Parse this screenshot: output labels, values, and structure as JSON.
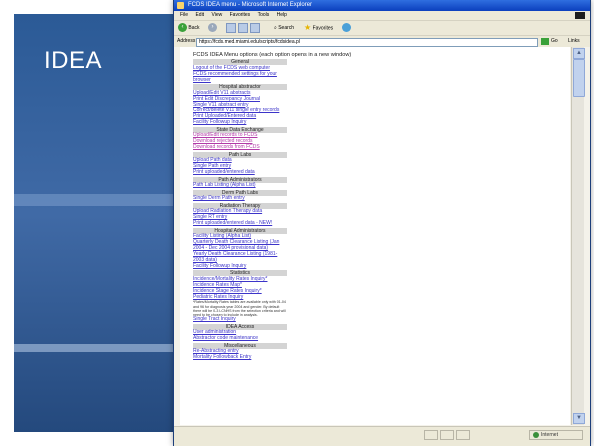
{
  "slide": {
    "title": "IDEA"
  },
  "browser": {
    "title": "FCDS IDEA menu - Microsoft Internet Explorer",
    "menu": [
      "File",
      "Edit",
      "View",
      "Favorites",
      "Tools",
      "Help"
    ],
    "toolbar": {
      "back": "Back",
      "search": "Search",
      "favorites": "Favorites"
    },
    "address": {
      "label": "Address",
      "url": "https://fcds.med.miami.edu/scripts/fcdsidea.pl",
      "go": "Go",
      "links": "Links"
    },
    "status": {
      "zone": "Internet"
    }
  },
  "page": {
    "intro": "FCDS IDEA Menu options (each option opens in a new window)",
    "sections": [
      {
        "header": "General",
        "links": [
          "Logout of the FCDS web computer",
          "FCDS recommended settings for your",
          "browser"
        ]
      },
      {
        "header": "Hospital abstractor",
        "links": [
          "Upload/Edit V11 abstracts",
          "Print Edit Discrepancy Journal",
          "Single V11 abstract entry",
          "Correct/delete V11 single entry records",
          "Print Uploaded/Entered data",
          "Facility Followup Inquiry"
        ]
      },
      {
        "header": "State Data Exchange",
        "links": [
          "Upload/Edit records to FCDS",
          "Download rejected records",
          "Download records from FCDS"
        ]
      },
      {
        "header": "Path Labs",
        "links": [
          "Upload Path data",
          "Single Path entry",
          "Print uploaded/entered data"
        ]
      },
      {
        "header": "Path Administrators",
        "links": [
          "Path Lab Listing (Alpha List)"
        ]
      },
      {
        "header": "Derm Path Labs",
        "links": [
          "Single Derm Path entry"
        ]
      },
      {
        "header": "Radiation Therapy",
        "links": [
          "Upload Radiation Therapy data",
          "Single RT entry",
          "Print uploaded/entered data - NEW!"
        ]
      },
      {
        "header": "Hospital Administrators",
        "links": [
          "Facility Listing (Alpha List)",
          "Quarterly Death Clearance Listing (Jan",
          "2004 - Dec 2004 provisional data)",
          "Yearly Death Clearance Listing (1981-",
          "2003 data)",
          "Facility Followup Inquiry"
        ]
      },
      {
        "header": "Statistics",
        "links": [
          "Incidence/Mortality Rates Inquiry*",
          "Incidence Rates Map*",
          "Incidence Stage Rates Inquiry*",
          "Pediatric Rates Inquiry"
        ],
        "note": "*Rates/Mortality Rates tables are available only with 01-04 and 96 for diagnosis year 2004 and gender. By default there will be 0-3 LCNHS from the selection criteria and will need to be chosen to include in analysis.",
        "after": [
          "Single Tract Inquiry"
        ]
      },
      {
        "header": "IDEA Access",
        "links": [
          "User administration",
          "Abstractor code maintenance"
        ]
      },
      {
        "header": "Miscellaneous",
        "links": [
          "Re-Abstracting entry",
          "Mortality Followback Entry"
        ]
      }
    ]
  }
}
